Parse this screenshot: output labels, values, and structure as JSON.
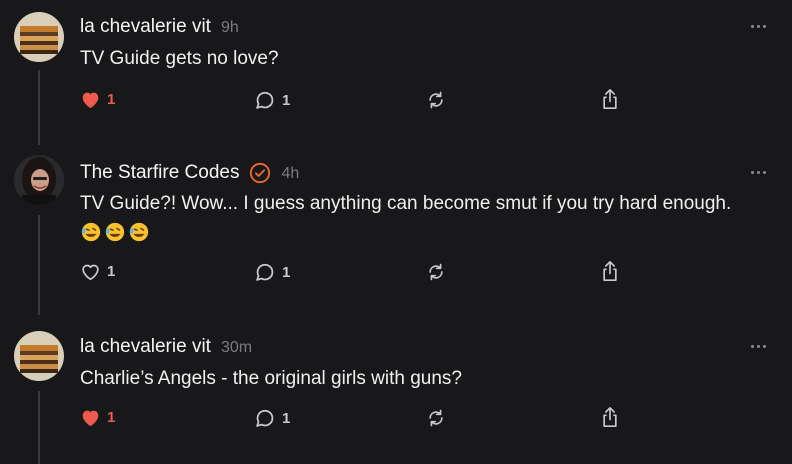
{
  "posts": [
    {
      "author": "la chevalerie vit",
      "time": "9h",
      "text": "TV Guide gets no love?",
      "likes": "1",
      "liked": true,
      "replies": "1",
      "verified": false
    },
    {
      "author": "The Starfire Codes",
      "time": "4h",
      "text": "TV Guide?! Wow... I guess anything can become smut if you try hard enough.",
      "emoji": [
        "🤣",
        "🤣",
        "🤣"
      ],
      "likes": "1",
      "liked": false,
      "replies": "1",
      "verified": true
    },
    {
      "author": "la chevalerie vit",
      "time": "30m",
      "text": "Charlie’s Angels - the original girls with guns?",
      "likes": "1",
      "liked": true,
      "replies": "1",
      "verified": false
    }
  ],
  "icons": {
    "like": "heart-icon",
    "reply": "comment-icon",
    "repost": "repost-icon",
    "share": "share-icon",
    "more": "more-options-icon",
    "verified": "verified-badge-icon"
  },
  "colors": {
    "background": "#18181a",
    "liked": "#ef5a4f",
    "verified": "#f06b2c"
  }
}
